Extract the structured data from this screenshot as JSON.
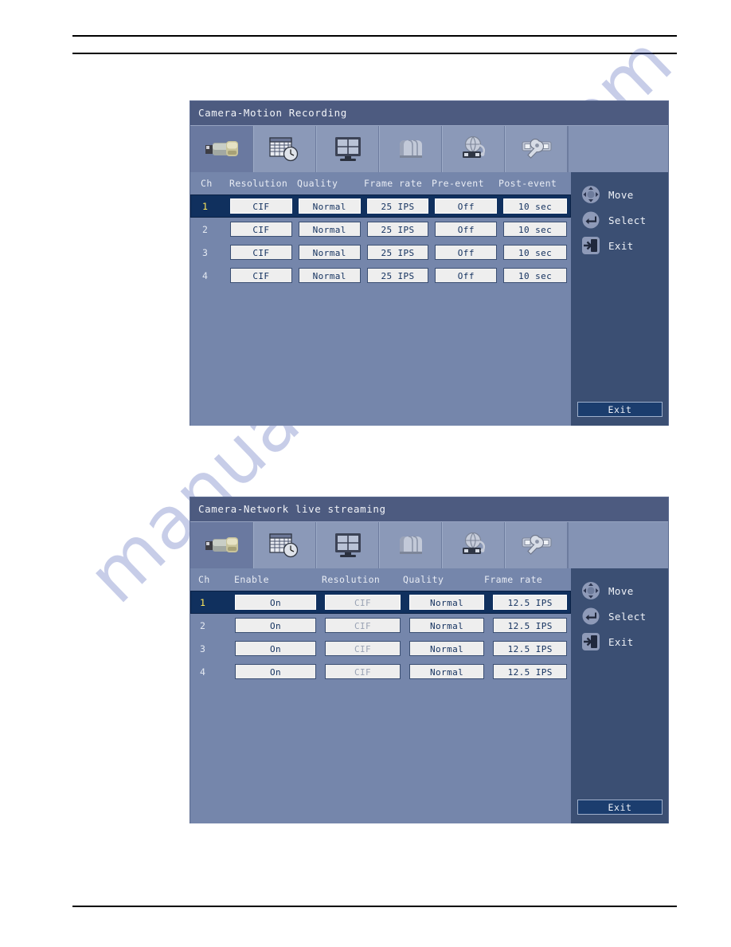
{
  "watermark": {
    "text": "manualsarchive.com"
  },
  "panels": [
    {
      "id": "recording",
      "title": "Camera-Motion Recording",
      "tabs": [
        {
          "name": "camera",
          "label": "Camera",
          "active": true
        },
        {
          "name": "schedule",
          "label": "Schedule",
          "active": false
        },
        {
          "name": "display",
          "label": "Display",
          "active": false
        },
        {
          "name": "storage",
          "label": "Storage",
          "active": false
        },
        {
          "name": "network",
          "label": "Network",
          "active": false
        },
        {
          "name": "system",
          "label": "System",
          "active": false
        }
      ],
      "columns": [
        "Ch",
        "Resolution",
        "Quality",
        "Frame rate",
        "Pre-event",
        "Post-event"
      ],
      "rows": [
        {
          "ch": "1",
          "selected": true,
          "resolution": "CIF",
          "quality": "Normal",
          "frame_rate": "25 IPS",
          "pre_event": "Off",
          "post_event": "10 sec"
        },
        {
          "ch": "2",
          "selected": false,
          "resolution": "CIF",
          "quality": "Normal",
          "frame_rate": "25 IPS",
          "pre_event": "Off",
          "post_event": "10 sec"
        },
        {
          "ch": "3",
          "selected": false,
          "resolution": "CIF",
          "quality": "Normal",
          "frame_rate": "25 IPS",
          "pre_event": "Off",
          "post_event": "10 sec"
        },
        {
          "ch": "4",
          "selected": false,
          "resolution": "CIF",
          "quality": "Normal",
          "frame_rate": "25 IPS",
          "pre_event": "Off",
          "post_event": "10 sec"
        }
      ],
      "legend": [
        {
          "icon": "dpad-icon",
          "label": "Move"
        },
        {
          "icon": "enter-icon",
          "label": "Select"
        },
        {
          "icon": "exit-icon",
          "label": "Exit"
        }
      ],
      "exit_button": "Exit"
    },
    {
      "id": "network",
      "title": "Camera-Network live streaming",
      "tabs": [
        {
          "name": "camera",
          "label": "Camera",
          "active": true
        },
        {
          "name": "schedule",
          "label": "Schedule",
          "active": false
        },
        {
          "name": "display",
          "label": "Display",
          "active": false
        },
        {
          "name": "storage",
          "label": "Storage",
          "active": false
        },
        {
          "name": "network",
          "label": "Network",
          "active": false
        },
        {
          "name": "system",
          "label": "System",
          "active": false
        }
      ],
      "columns": [
        "Ch",
        "Enable",
        "Resolution",
        "Quality",
        "Frame rate"
      ],
      "rows": [
        {
          "ch": "1",
          "selected": true,
          "enable": "On",
          "resolution": "CIF",
          "quality": "Normal",
          "frame_rate": "12.5 IPS"
        },
        {
          "ch": "2",
          "selected": false,
          "enable": "On",
          "resolution": "CIF",
          "quality": "Normal",
          "frame_rate": "12.5 IPS"
        },
        {
          "ch": "3",
          "selected": false,
          "enable": "On",
          "resolution": "CIF",
          "quality": "Normal",
          "frame_rate": "12.5 IPS"
        },
        {
          "ch": "4",
          "selected": false,
          "enable": "On",
          "resolution": "CIF",
          "quality": "Normal",
          "frame_rate": "12.5 IPS"
        }
      ],
      "legend": [
        {
          "icon": "dpad-icon",
          "label": "Move"
        },
        {
          "icon": "enter-icon",
          "label": "Select"
        },
        {
          "icon": "exit-icon",
          "label": "Exit"
        }
      ],
      "exit_button": "Exit"
    }
  ],
  "colors": {
    "title_bar": "#4d5b80",
    "panel_body": "#7586ab",
    "sidebar": "#3b4f73",
    "selected_row": "#10305e",
    "selected_ch_text": "#ffe75a",
    "field_bg": "#eeeeee",
    "field_text": "#12305e"
  }
}
